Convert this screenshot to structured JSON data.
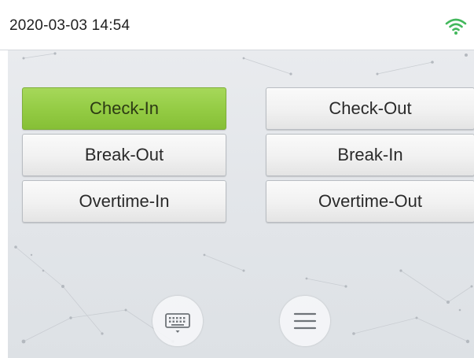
{
  "status_bar": {
    "datetime": "2020-03-03 14:54",
    "wifi_icon": "wifi-icon",
    "wifi_color": "#43b85c"
  },
  "attendance_buttons": [
    {
      "label": "Check-In",
      "selected": true
    },
    {
      "label": "Check-Out",
      "selected": false
    },
    {
      "label": "Break-Out",
      "selected": false
    },
    {
      "label": "Break-In",
      "selected": false
    },
    {
      "label": "Overtime-In",
      "selected": false
    },
    {
      "label": "Overtime-Out",
      "selected": false
    }
  ],
  "bottom_controls": {
    "keyboard_icon": "keyboard-icon",
    "menu_icon": "menu-icon"
  },
  "colors": {
    "selected_button": "#93cb43",
    "button": "#f1f1f1",
    "background": "#e5e8eb"
  }
}
